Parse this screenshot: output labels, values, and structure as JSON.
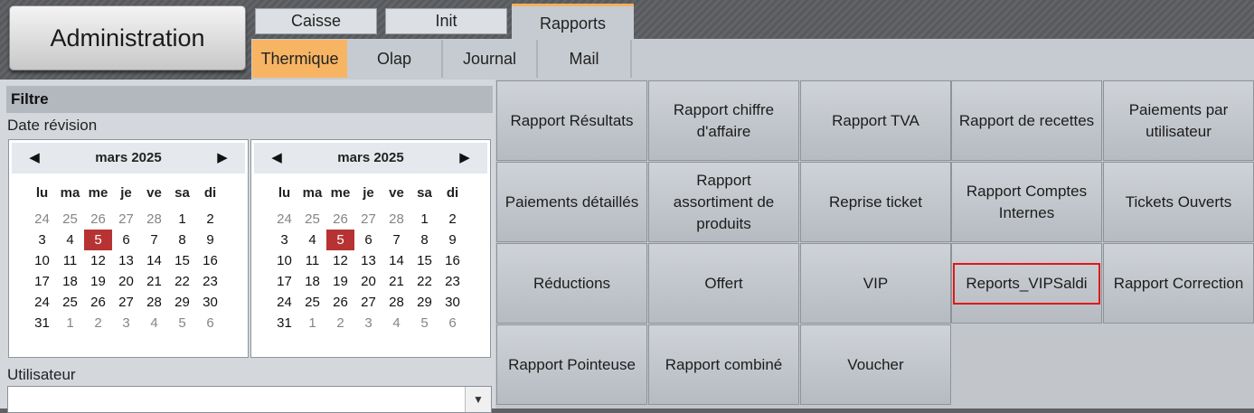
{
  "header": {
    "admin_label": "Administration"
  },
  "tabs": [
    {
      "label": "Caisse",
      "active": false
    },
    {
      "label": "Init",
      "active": false
    },
    {
      "label": "Rapports",
      "active": true
    }
  ],
  "subtabs": [
    {
      "label": "Thermique",
      "active": true
    },
    {
      "label": "Olap",
      "active": false
    },
    {
      "label": "Journal",
      "active": false
    },
    {
      "label": "Mail",
      "active": false
    }
  ],
  "filter": {
    "title": "Filtre",
    "date_label": "Date révision",
    "user_label": "Utilisateur",
    "user_value": ""
  },
  "calendars": [
    {
      "month": "mars 2025",
      "weekdays": [
        "lu",
        "ma",
        "me",
        "je",
        "ve",
        "sa",
        "di"
      ],
      "days": [
        [
          "24",
          "25",
          "26",
          "27",
          "28",
          "1",
          "2"
        ],
        [
          "3",
          "4",
          "5",
          "6",
          "7",
          "8",
          "9"
        ],
        [
          "10",
          "11",
          "12",
          "13",
          "14",
          "15",
          "16"
        ],
        [
          "17",
          "18",
          "19",
          "20",
          "21",
          "22",
          "23"
        ],
        [
          "24",
          "25",
          "26",
          "27",
          "28",
          "29",
          "30"
        ],
        [
          "31",
          "1",
          "2",
          "3",
          "4",
          "5",
          "6"
        ]
      ],
      "selected": "5"
    },
    {
      "month": "mars 2025",
      "weekdays": [
        "lu",
        "ma",
        "me",
        "je",
        "ve",
        "sa",
        "di"
      ],
      "days": [
        [
          "24",
          "25",
          "26",
          "27",
          "28",
          "1",
          "2"
        ],
        [
          "3",
          "4",
          "5",
          "6",
          "7",
          "8",
          "9"
        ],
        [
          "10",
          "11",
          "12",
          "13",
          "14",
          "15",
          "16"
        ],
        [
          "17",
          "18",
          "19",
          "20",
          "21",
          "22",
          "23"
        ],
        [
          "24",
          "25",
          "26",
          "27",
          "28",
          "29",
          "30"
        ],
        [
          "31",
          "1",
          "2",
          "3",
          "4",
          "5",
          "6"
        ]
      ],
      "selected": "5"
    }
  ],
  "reports": [
    "Rapport Résultats",
    "Rapport chiffre d'affaire",
    "Rapport TVA",
    "Rapport de recettes",
    "Paiements par utilisateur",
    "Paiements détaillés",
    "Rapport assortiment de produits",
    "Reprise ticket",
    "Rapport Comptes Internes",
    "Tickets Ouverts",
    "Réductions",
    "Offert",
    "VIP",
    "Reports_VIPSaldi",
    "Rapport Correction",
    "Rapport Pointeuse",
    "Rapport combiné",
    "Voucher"
  ],
  "highlight_color": "#e01818",
  "accent_color": "#f7b564",
  "selected_day_color": "#b73232"
}
